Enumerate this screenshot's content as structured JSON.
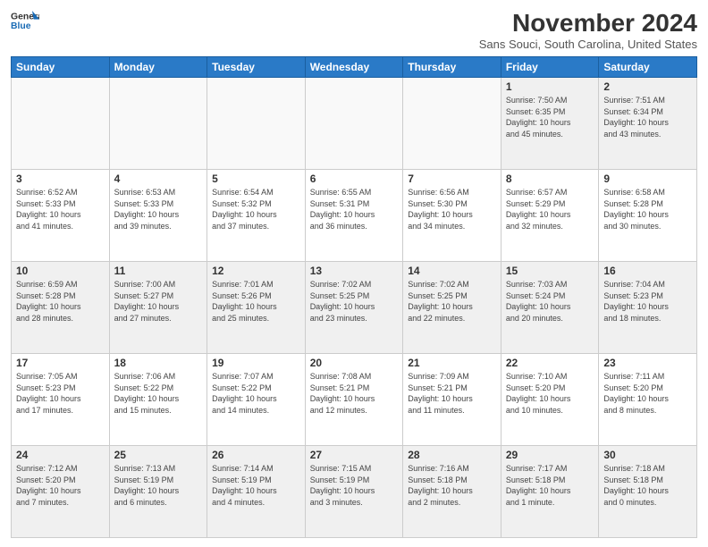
{
  "header": {
    "logo_line1": "General",
    "logo_line2": "Blue",
    "month_title": "November 2024",
    "subtitle": "Sans Souci, South Carolina, United States"
  },
  "weekdays": [
    "Sunday",
    "Monday",
    "Tuesday",
    "Wednesday",
    "Thursday",
    "Friday",
    "Saturday"
  ],
  "weeks": [
    [
      {
        "day": "",
        "info": ""
      },
      {
        "day": "",
        "info": ""
      },
      {
        "day": "",
        "info": ""
      },
      {
        "day": "",
        "info": ""
      },
      {
        "day": "",
        "info": ""
      },
      {
        "day": "1",
        "info": "Sunrise: 7:50 AM\nSunset: 6:35 PM\nDaylight: 10 hours\nand 45 minutes."
      },
      {
        "day": "2",
        "info": "Sunrise: 7:51 AM\nSunset: 6:34 PM\nDaylight: 10 hours\nand 43 minutes."
      }
    ],
    [
      {
        "day": "3",
        "info": "Sunrise: 6:52 AM\nSunset: 5:33 PM\nDaylight: 10 hours\nand 41 minutes."
      },
      {
        "day": "4",
        "info": "Sunrise: 6:53 AM\nSunset: 5:33 PM\nDaylight: 10 hours\nand 39 minutes."
      },
      {
        "day": "5",
        "info": "Sunrise: 6:54 AM\nSunset: 5:32 PM\nDaylight: 10 hours\nand 37 minutes."
      },
      {
        "day": "6",
        "info": "Sunrise: 6:55 AM\nSunset: 5:31 PM\nDaylight: 10 hours\nand 36 minutes."
      },
      {
        "day": "7",
        "info": "Sunrise: 6:56 AM\nSunset: 5:30 PM\nDaylight: 10 hours\nand 34 minutes."
      },
      {
        "day": "8",
        "info": "Sunrise: 6:57 AM\nSunset: 5:29 PM\nDaylight: 10 hours\nand 32 minutes."
      },
      {
        "day": "9",
        "info": "Sunrise: 6:58 AM\nSunset: 5:28 PM\nDaylight: 10 hours\nand 30 minutes."
      }
    ],
    [
      {
        "day": "10",
        "info": "Sunrise: 6:59 AM\nSunset: 5:28 PM\nDaylight: 10 hours\nand 28 minutes."
      },
      {
        "day": "11",
        "info": "Sunrise: 7:00 AM\nSunset: 5:27 PM\nDaylight: 10 hours\nand 27 minutes."
      },
      {
        "day": "12",
        "info": "Sunrise: 7:01 AM\nSunset: 5:26 PM\nDaylight: 10 hours\nand 25 minutes."
      },
      {
        "day": "13",
        "info": "Sunrise: 7:02 AM\nSunset: 5:25 PM\nDaylight: 10 hours\nand 23 minutes."
      },
      {
        "day": "14",
        "info": "Sunrise: 7:02 AM\nSunset: 5:25 PM\nDaylight: 10 hours\nand 22 minutes."
      },
      {
        "day": "15",
        "info": "Sunrise: 7:03 AM\nSunset: 5:24 PM\nDaylight: 10 hours\nand 20 minutes."
      },
      {
        "day": "16",
        "info": "Sunrise: 7:04 AM\nSunset: 5:23 PM\nDaylight: 10 hours\nand 18 minutes."
      }
    ],
    [
      {
        "day": "17",
        "info": "Sunrise: 7:05 AM\nSunset: 5:23 PM\nDaylight: 10 hours\nand 17 minutes."
      },
      {
        "day": "18",
        "info": "Sunrise: 7:06 AM\nSunset: 5:22 PM\nDaylight: 10 hours\nand 15 minutes."
      },
      {
        "day": "19",
        "info": "Sunrise: 7:07 AM\nSunset: 5:22 PM\nDaylight: 10 hours\nand 14 minutes."
      },
      {
        "day": "20",
        "info": "Sunrise: 7:08 AM\nSunset: 5:21 PM\nDaylight: 10 hours\nand 12 minutes."
      },
      {
        "day": "21",
        "info": "Sunrise: 7:09 AM\nSunset: 5:21 PM\nDaylight: 10 hours\nand 11 minutes."
      },
      {
        "day": "22",
        "info": "Sunrise: 7:10 AM\nSunset: 5:20 PM\nDaylight: 10 hours\nand 10 minutes."
      },
      {
        "day": "23",
        "info": "Sunrise: 7:11 AM\nSunset: 5:20 PM\nDaylight: 10 hours\nand 8 minutes."
      }
    ],
    [
      {
        "day": "24",
        "info": "Sunrise: 7:12 AM\nSunset: 5:20 PM\nDaylight: 10 hours\nand 7 minutes."
      },
      {
        "day": "25",
        "info": "Sunrise: 7:13 AM\nSunset: 5:19 PM\nDaylight: 10 hours\nand 6 minutes."
      },
      {
        "day": "26",
        "info": "Sunrise: 7:14 AM\nSunset: 5:19 PM\nDaylight: 10 hours\nand 4 minutes."
      },
      {
        "day": "27",
        "info": "Sunrise: 7:15 AM\nSunset: 5:19 PM\nDaylight: 10 hours\nand 3 minutes."
      },
      {
        "day": "28",
        "info": "Sunrise: 7:16 AM\nSunset: 5:18 PM\nDaylight: 10 hours\nand 2 minutes."
      },
      {
        "day": "29",
        "info": "Sunrise: 7:17 AM\nSunset: 5:18 PM\nDaylight: 10 hours\nand 1 minute."
      },
      {
        "day": "30",
        "info": "Sunrise: 7:18 AM\nSunset: 5:18 PM\nDaylight: 10 hours\nand 0 minutes."
      }
    ]
  ]
}
